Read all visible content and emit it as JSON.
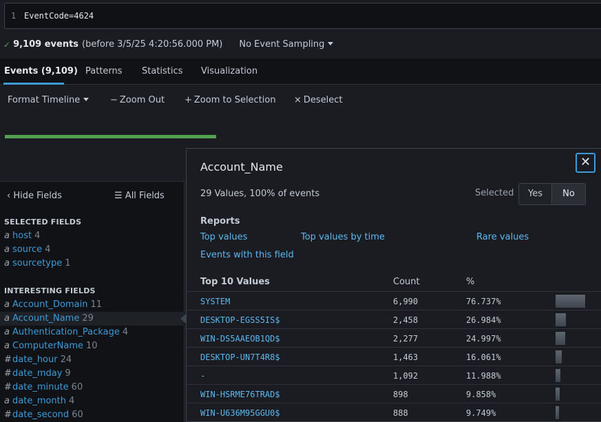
{
  "search": {
    "line_number": "1",
    "query": "EventCode=4624"
  },
  "status": {
    "events_count": "9,109 events",
    "time_range": "(before 3/5/25 4:20:56.000 PM)",
    "sampling": "No Event Sampling"
  },
  "tabs": [
    {
      "label": "Events (9,109)",
      "active": true
    },
    {
      "label": "Patterns"
    },
    {
      "label": "Statistics"
    },
    {
      "label": "Visualization"
    }
  ],
  "timeline": {
    "format": "Format Timeline",
    "zoom_out": "Zoom Out",
    "zoom_selection": "Zoom to Selection",
    "deselect": "Deselect"
  },
  "sidebar": {
    "hide_fields": "Hide Fields",
    "all_fields": "All Fields",
    "selected_title": "SELECTED FIELDS",
    "interesting_title": "INTERESTING FIELDS",
    "selected_fields": [
      {
        "type": "a",
        "name": "host",
        "count": "4"
      },
      {
        "type": "a",
        "name": "source",
        "count": "4"
      },
      {
        "type": "a",
        "name": "sourcetype",
        "count": "1"
      }
    ],
    "interesting_fields": [
      {
        "type": "a",
        "name": "Account_Domain",
        "count": "11"
      },
      {
        "type": "a",
        "name": "Account_Name",
        "count": "29"
      },
      {
        "type": "a",
        "name": "Authentication_Package",
        "count": "4"
      },
      {
        "type": "a",
        "name": "ComputerName",
        "count": "10"
      },
      {
        "type": "#",
        "name": "date_hour",
        "count": "24"
      },
      {
        "type": "#",
        "name": "date_mday",
        "count": "9"
      },
      {
        "type": "#",
        "name": "date_minute",
        "count": "60"
      },
      {
        "type": "a",
        "name": "date_month",
        "count": "4"
      },
      {
        "type": "#",
        "name": "date_second",
        "count": "60"
      }
    ]
  },
  "popover": {
    "title": "Account_Name",
    "close": "✕",
    "summary": "29 Values, 100% of events",
    "selected_label": "Selected",
    "yes": "Yes",
    "no": "No",
    "reports_title": "Reports",
    "reports": {
      "top_values": "Top values",
      "top_by_time": "Top values by time",
      "rare_values": "Rare values",
      "events_with_field": "Events with this field"
    },
    "table_headers": {
      "value": "Top 10 Values",
      "count": "Count",
      "pct": "%"
    },
    "rows": [
      {
        "value": "SYSTEM",
        "count": "6,990",
        "pct": "76.737%",
        "fraction": 0.76737
      },
      {
        "value": "DESKTOP-EGSS5IS$",
        "count": "2,458",
        "pct": "26.984%",
        "fraction": 0.26984
      },
      {
        "value": "WIN-DS5AAEOB1QD$",
        "count": "2,277",
        "pct": "24.997%",
        "fraction": 0.24997
      },
      {
        "value": "DESKTOP-UN7T4R8$",
        "count": "1,463",
        "pct": "16.061%",
        "fraction": 0.16061
      },
      {
        "value": "-",
        "count": "1,092",
        "pct": "11.988%",
        "fraction": 0.11988
      },
      {
        "value": "WIN-HSRME76TRAD$",
        "count": "898",
        "pct": "9.858%",
        "fraction": 0.09858
      },
      {
        "value": "WIN-U636M95GGU0$",
        "count": "888",
        "pct": "9.749%",
        "fraction": 0.09749
      }
    ]
  }
}
